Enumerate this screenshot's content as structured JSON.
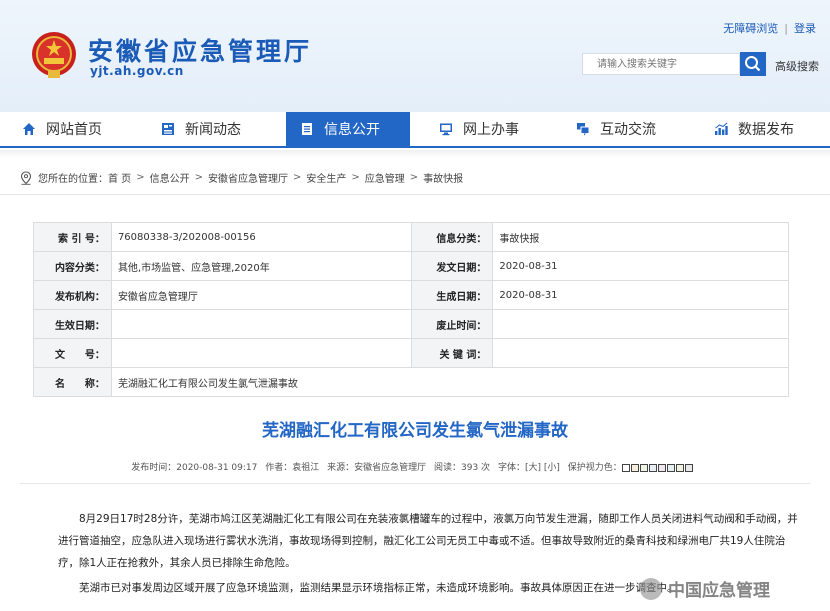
{
  "header": {
    "site_title": "安徽省应急管理厅",
    "site_domain": "yjt.ah.gov.cn",
    "accessible_link": "无障碍浏览",
    "login_link": "登录",
    "search_placeholder": "请输入搜索关键字",
    "advanced_search": "高级搜索",
    "icons": [
      "national-emblem",
      "search-icon"
    ]
  },
  "nav": {
    "items": [
      {
        "label": "网站首页",
        "icon": "home-icon",
        "active": false
      },
      {
        "label": "新闻动态",
        "icon": "news-icon",
        "active": false
      },
      {
        "label": "信息公开",
        "icon": "document-icon",
        "active": true
      },
      {
        "label": "网上办事",
        "icon": "monitor-icon",
        "active": false
      },
      {
        "label": "互动交流",
        "icon": "chat-icon",
        "active": false
      },
      {
        "label": "数据发布",
        "icon": "chart-icon",
        "active": false
      }
    ],
    "active_color": "#2266c6"
  },
  "breadcrumb": {
    "prefix": "您所在的位置：",
    "items": [
      "首 页",
      "信息公开",
      "安徽省应急管理厅",
      "安全生产",
      "应急管理",
      "事故快报"
    ]
  },
  "info_table": {
    "index_no_label": "索 引 号：",
    "index_no": "76080338-3/202008-00156",
    "info_class_label": "信息分类：",
    "info_class": "事故快报",
    "content_class_label": "内容分类：",
    "content_class": "其他,市场监管、应急管理,2020年",
    "publish_date_label": "发文日期：",
    "publish_date": "2020-08-31",
    "issuer_label": "发布机构：",
    "issuer": "安徽省应急管理厅",
    "generate_date_label": "生成日期：",
    "generate_date": "2020-08-31",
    "effective_date_label": "生效日期：",
    "effective_date": "",
    "abolish_date_label": "废止时间：",
    "abolish_date": "",
    "doc_no_label": "文　　号：",
    "doc_no": "",
    "keywords_label": "关 键 词：",
    "keywords": "",
    "name_label": "名　　称：",
    "name": "芜湖融汇化工有限公司发生氯气泄漏事故"
  },
  "article": {
    "title": "芜湖融汇化工有限公司发生氯气泄漏事故",
    "meta_time": "发布时间：2020-08-31 09:17",
    "meta_author": "作者：袁祖江",
    "meta_source": "来源：安徽省应急管理厅",
    "meta_views": "阅读：393 次",
    "meta_font": "字体：[大] [小]",
    "meta_eye": "保护视力色：",
    "eye_colors": [
      "#ffffff",
      "#f6efe0",
      "#eef5e4",
      "#e9eef4",
      "#f0e6ef",
      "#e6f0f0",
      "#f2f2e3",
      "#e9e9e9"
    ],
    "p1": "8月29日17时28分许，芜湖市鸠江区芜湖融汇化工有限公司在充装液氯槽罐车的过程中，液氯万向节发生泄漏，随即工作人员关闭进料气动阀和手动阀，并进行管道抽空，应急队进入现场进行雾状水洗消，事故现场得到控制，融汇化工公司无员工中毒或不适。但事故导致附近的桑青科技和绿洲电厂共19人住院治疗，除1人正在抢救外，其余人员已排除生命危险。",
    "p2": "芜湖市已对事发周边区域开展了应急环境监测，监测结果显示环境指标正常，未造成环境影响。事故具体原因正在进一步调查中。"
  },
  "watermark": {
    "text": "中国应急管理"
  }
}
